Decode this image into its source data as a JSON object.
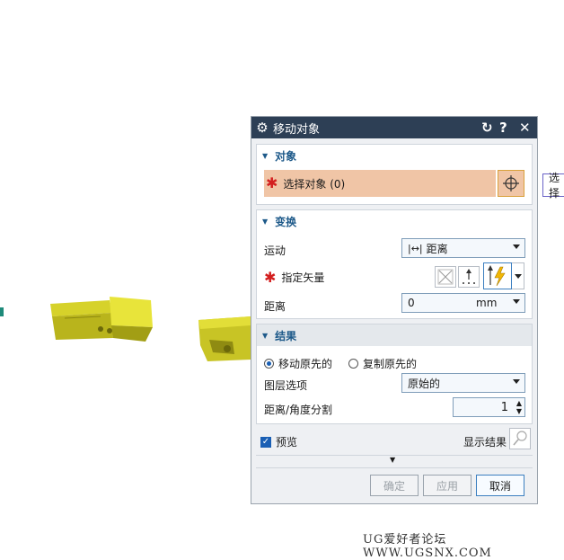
{
  "dialog": {
    "title": "移动对象",
    "object_section": {
      "title": "对象",
      "select_label": "选择对象 (0)"
    },
    "transform_section": {
      "title": "变换",
      "motion_label": "运动",
      "motion_value": "距离",
      "vector_label": "指定矢量",
      "distance_label": "距离",
      "distance_value": "0",
      "distance_unit": "mm"
    },
    "result_section": {
      "title": "结果",
      "move_original": "移动原先的",
      "copy_original": "复制原先的",
      "layer_label": "图层选项",
      "layer_value": "原始的",
      "split_label": "距离/角度分割",
      "split_value": "1"
    },
    "preview_label": "预览",
    "show_result_label": "显示结果",
    "buttons": {
      "ok": "确定",
      "apply": "应用",
      "cancel": "取消"
    }
  },
  "tooltip_fragment": "选择",
  "watermark": "UG爱好者论坛 WWW.UGSNX.COM"
}
